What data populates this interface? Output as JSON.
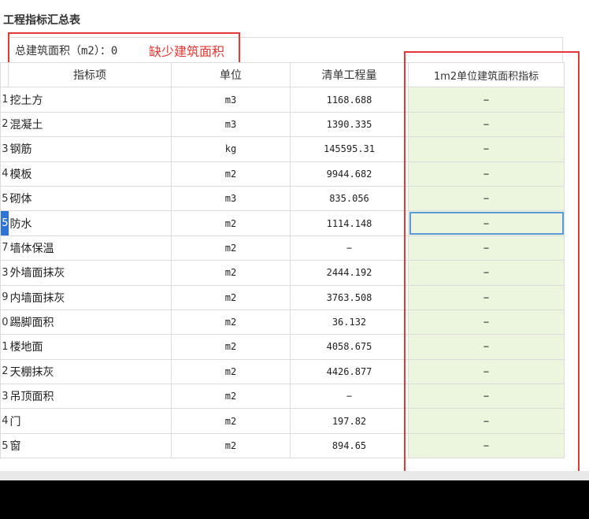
{
  "panel": {
    "title": "工程指标汇总表"
  },
  "summary": {
    "label": "总建筑面积（m2）：0",
    "warning": "缺少建筑面积"
  },
  "table": {
    "headers": [
      "指标项",
      "单位",
      "清单工程量",
      "1m2单位建筑面积指标"
    ],
    "rows": [
      {
        "num": "1",
        "name": "挖土方",
        "unit": "m3",
        "qty": "1168.688",
        "metric": "−"
      },
      {
        "num": "2",
        "name": "混凝土",
        "unit": "m3",
        "qty": "1390.335",
        "metric": "−"
      },
      {
        "num": "3",
        "name": "钢筋",
        "unit": "kg",
        "qty": "145595.31",
        "metric": "−"
      },
      {
        "num": "4",
        "name": "模板",
        "unit": "m2",
        "qty": "9944.682",
        "metric": "−"
      },
      {
        "num": "5",
        "name": "砌体",
        "unit": "m3",
        "qty": "835.056",
        "metric": "−"
      },
      {
        "num": "5",
        "name": "防水",
        "unit": "m2",
        "qty": "1114.148",
        "metric": "−"
      },
      {
        "num": "7",
        "name": "墙体保温",
        "unit": "m2",
        "qty": "−",
        "metric": "−"
      },
      {
        "num": "3",
        "name": "外墙面抹灰",
        "unit": "m2",
        "qty": "2444.192",
        "metric": "−"
      },
      {
        "num": "9",
        "name": "内墙面抹灰",
        "unit": "m2",
        "qty": "3763.508",
        "metric": "−"
      },
      {
        "num": "0",
        "name": "踢脚面积",
        "unit": "m2",
        "qty": "36.132",
        "metric": "−"
      },
      {
        "num": "1",
        "name": "楼地面",
        "unit": "m2",
        "qty": "4058.675",
        "metric": "−"
      },
      {
        "num": "2",
        "name": "天棚抹灰",
        "unit": "m2",
        "qty": "4426.877",
        "metric": "−"
      },
      {
        "num": "3",
        "name": "吊顶面积",
        "unit": "m2",
        "qty": "−",
        "metric": "−"
      },
      {
        "num": "4",
        "name": "门",
        "unit": "m2",
        "qty": "197.82",
        "metric": "−"
      },
      {
        "num": "5",
        "name": "窗",
        "unit": "m2",
        "qty": "894.65",
        "metric": "−"
      }
    ]
  },
  "colors": {
    "warning": "#e53935",
    "metric_bg": "#ecf6df",
    "selection": "#5b9bd5",
    "row_active": "#2f73d6"
  }
}
